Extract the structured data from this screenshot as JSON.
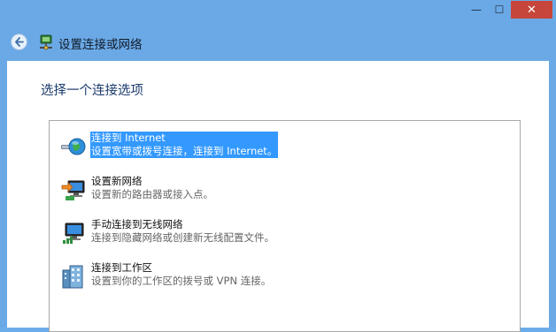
{
  "window": {
    "min_glyph": "—",
    "max_glyph": "☐",
    "close_glyph": "✕"
  },
  "nav": {
    "title": "设置连接或网络"
  },
  "main": {
    "heading": "选择一个连接选项",
    "options": [
      {
        "title": "连接到 Internet",
        "desc": "设置宽带或拨号连接，连接到 Internet。",
        "icon": "globe-network-icon",
        "selected": true
      },
      {
        "title": "设置新网络",
        "desc": "设置新的路由器或接入点。",
        "icon": "new-network-icon",
        "selected": false
      },
      {
        "title": "手动连接到无线网络",
        "desc": "连接到隐藏网络或创建新无线配置文件。",
        "icon": "wireless-network-icon",
        "selected": false
      },
      {
        "title": "连接到工作区",
        "desc": "设置到你的工作区的拨号或 VPN 连接。",
        "icon": "workplace-building-icon",
        "selected": false
      }
    ]
  },
  "colors": {
    "titlebar": "#6ba9e6",
    "selection": "#3399ff",
    "close_button": "#c7463b"
  }
}
